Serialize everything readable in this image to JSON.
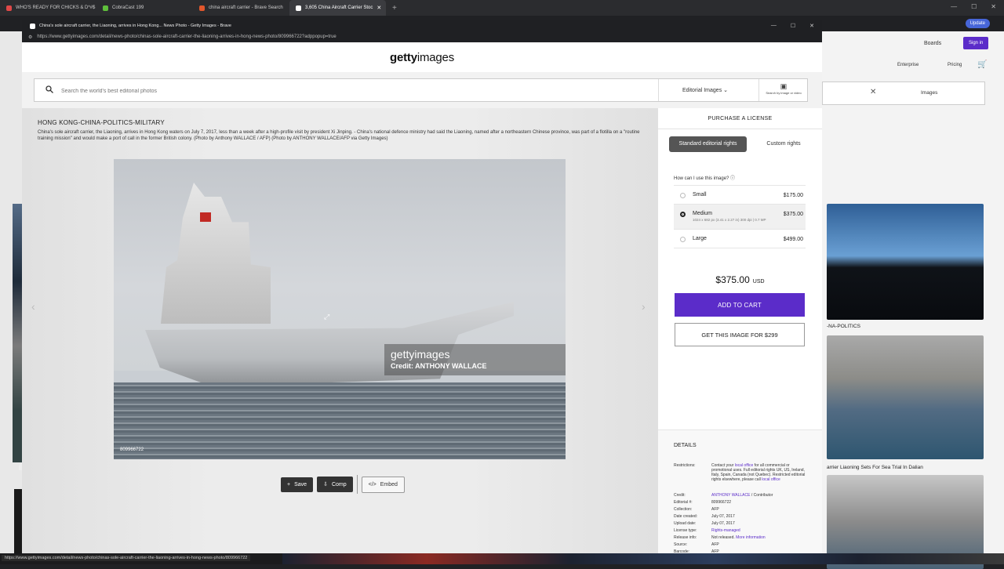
{
  "browser": {
    "tabs": [
      {
        "label": "WHO'S READY FOR CHICKS & D*#$",
        "color": "#e04848"
      },
      {
        "label": "CobraCast 199",
        "color": "#5fbf3b"
      },
      {
        "label": "china aircraft carrier - Brave Search",
        "color": "#e2572c"
      },
      {
        "label": "3,605 China Aircraft Carrier Stoc",
        "color": "#ffffff"
      }
    ],
    "new_tab": "+",
    "update_label": "Update"
  },
  "popup": {
    "title": "China's sole aircraft carrier, the Liaoning, arrives in Hong Kong... News Photo - Getty Images - Brave",
    "url": "https://www.gettyimages.com/detail/news-photo/chinas-sole-aircraft-carrier-the-liaoning-arrives-in-hong-news-photo/809966722?adppopup=true"
  },
  "header": {
    "logo_bold": "getty",
    "logo_rest": "images"
  },
  "search": {
    "placeholder": "Search the world's best editorial photos",
    "filter_label": "Editorial Images",
    "visual_search_label": "Search by image or video"
  },
  "image": {
    "title": "HONG KONG-CHINA-POLITICS-MILITARY",
    "description": "China's sole aircraft carrier, the Liaoning, arrives in Hong Kong waters on July 7, 2017, less than a week after a high-profile visit by president Xi Jinping. - China's national defence ministry had said the Liaoning, named after a northeastern Chinese province, was part of a flotilla on a \"routine training mission\" and would make a port of call in the former British colony. (Photo by Anthony WALLACE / AFP) (Photo by ANTHONY WALLACE/AFP via Getty Images)",
    "watermark_logo": "gettyimages",
    "watermark_credit": "Credit: ANTHONY WALLACE",
    "id": "809966722",
    "actions": {
      "save": "Save",
      "comp": "Comp",
      "embed": "Embed"
    }
  },
  "license": {
    "heading": "PURCHASE A LICENSE",
    "tab_standard": "Standard editorial rights",
    "tab_custom": "Custom rights",
    "question": "How can I use this image?",
    "sizes": [
      {
        "name": "Small",
        "price": "$175.00",
        "meta": ""
      },
      {
        "name": "Medium",
        "price": "$375.00",
        "meta": "1024 x 682 px (3.41 x 2.27 in) 300 dpi | 0.7 MP"
      },
      {
        "name": "Large",
        "price": "$499.00",
        "meta": ""
      }
    ],
    "total": "$375.00",
    "currency": "USD",
    "add_to_cart": "ADD TO CART",
    "get_image": "GET THIS IMAGE FOR $299"
  },
  "details": {
    "heading": "DETAILS",
    "restrictions_key": "Restrictions:",
    "restrictions_a": "Contact your ",
    "restrictions_link": "local office",
    "restrictions_b": " for all commercial or promotional uses. Full editorial rights UK, US, Ireland, Italy, Spain, Canada (not Quebec). Restricted editorial rights elsewhere, please call ",
    "restrictions_link2": "local office",
    "rows": [
      {
        "k": "Credit:",
        "v": "ANTHONY WALLACE",
        "v2": " / Contributor"
      },
      {
        "k": "Editorial #:",
        "v": "809966722",
        "v2": ""
      },
      {
        "k": "Collection:",
        "v": "AFP",
        "v2": ""
      },
      {
        "k": "Date created:",
        "v": "July 07, 2017",
        "v2": ""
      },
      {
        "k": "Upload date:",
        "v": "July 07, 2017",
        "v2": ""
      },
      {
        "k": "License type:",
        "v": "Rights-managed",
        "v2": ""
      },
      {
        "k": "Release info:",
        "v": "Not released.",
        "v2": " More information"
      },
      {
        "k": "Source:",
        "v": "AFP",
        "v2": ""
      },
      {
        "k": "Barcode:",
        "v": "AFP",
        "v2": ""
      }
    ]
  },
  "background_page": {
    "boards": "Boards",
    "sign_in": "Sign in",
    "enterprise": "Enterprise",
    "pricing": "Pricing",
    "filter_images": "Images",
    "caption_1": "-NA-POLITICS",
    "caption_2": "arrier Liaoning Sets For Sea Trial In Dalian"
  },
  "status_url": "https://www.gettyimages.com/detail/news-photo/chinas-sole-aircraft-carrier-the-liaoning-arrives-in-hong-news-photo/809966722"
}
